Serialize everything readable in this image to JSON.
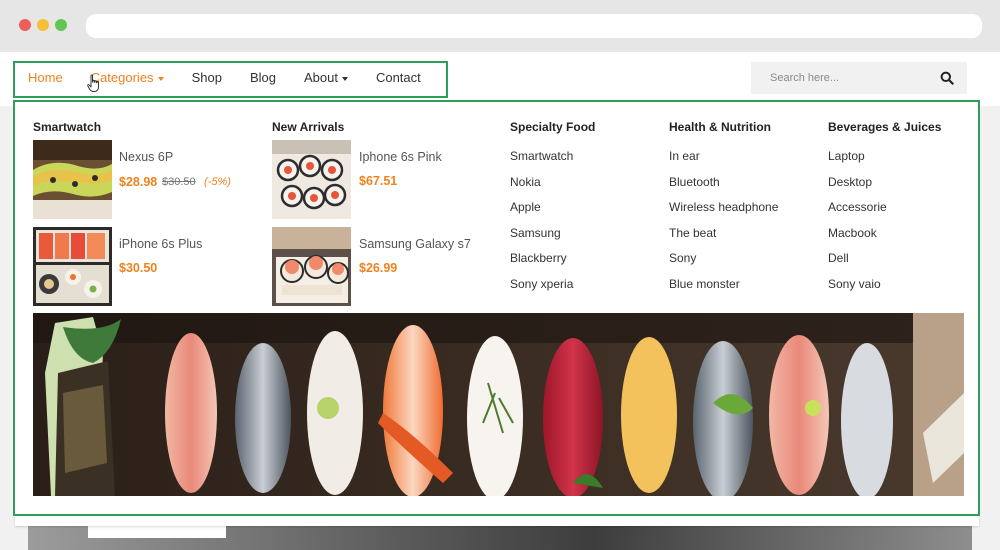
{
  "nav": {
    "items": [
      {
        "label": "Home",
        "state": "active"
      },
      {
        "label": "Categories",
        "has_dropdown": true,
        "state": "hover"
      },
      {
        "label": "Shop"
      },
      {
        "label": "Blog"
      },
      {
        "label": "About",
        "has_dropdown": true
      },
      {
        "label": "Contact"
      }
    ]
  },
  "search": {
    "placeholder": "Search here..."
  },
  "mega_menu": {
    "smartwatch": {
      "title": "Smartwatch",
      "products": [
        {
          "name": "Nexus 6P",
          "price": "$28.98",
          "old_price": "$30.50",
          "discount": "(-5%)"
        },
        {
          "name": "iPhone 6s Plus",
          "price": "$30.50"
        }
      ]
    },
    "new_arrivals": {
      "title": "New Arrivals",
      "products": [
        {
          "name": "Iphone 6s Pink",
          "price": "$67.51"
        },
        {
          "name": "Samsung Galaxy s7",
          "price": "$26.99"
        }
      ]
    },
    "specialty_food": {
      "title": "Specialty Food",
      "links": [
        "Smartwatch",
        "Nokia",
        "Apple",
        "Samsung",
        "Blackberry",
        "Sony xperia"
      ]
    },
    "health_nutrition": {
      "title": "Health & Nutrition",
      "links": [
        "In ear",
        "Bluetooth",
        "Wireless headphone",
        "The beat",
        "Sony",
        "Blue monster"
      ]
    },
    "beverages_juices": {
      "title": "Beverages & Juices",
      "links": [
        "Laptop",
        "Desktop",
        "Accessorie",
        "Macbook",
        "Dell",
        "Sony vaio"
      ]
    }
  },
  "colors": {
    "accent": "#f0821e",
    "highlight_border": "#2e9e5b"
  }
}
